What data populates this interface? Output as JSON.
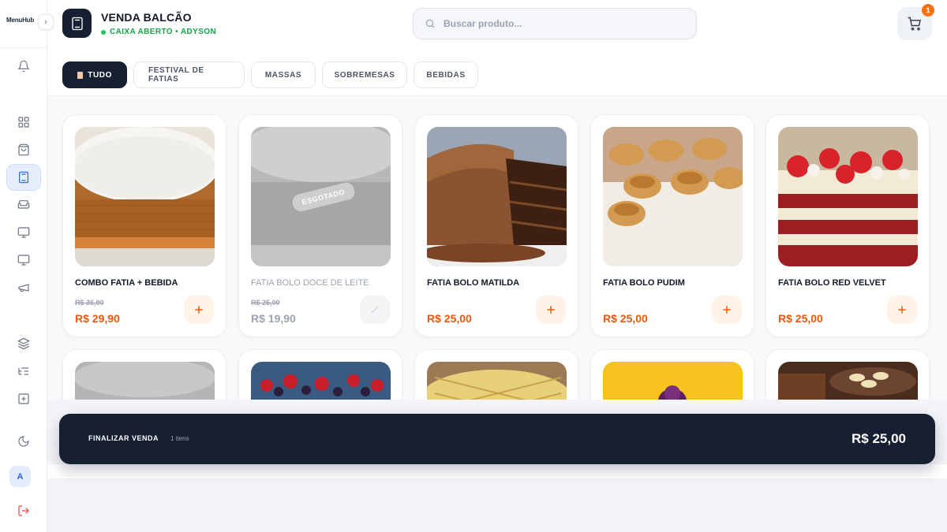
{
  "sidebar": {
    "logo": "MenuHub",
    "avatar_initial": "A",
    "icons": [
      "bell-icon",
      "grid-icon",
      "bag-icon",
      "calculator-icon",
      "sofa-icon",
      "monitor-icon",
      "display-icon",
      "megaphone-icon",
      "layers-icon",
      "tree-icon",
      "plus-square-icon",
      "moon-icon",
      "logout-icon"
    ],
    "active_icon": "calculator-icon"
  },
  "header": {
    "title": "VENDA BALCÃO",
    "status": "CAIXA ABERTO • ADYSON",
    "search_placeholder": "Buscar produto...",
    "cart_count": "1"
  },
  "tabs": [
    {
      "label": "TUDO",
      "active": true
    },
    {
      "label": "FESTIVAL DE FATIAS",
      "active": false
    },
    {
      "label": "MASSAS",
      "active": false
    },
    {
      "label": "SOBREMESAS",
      "active": false
    },
    {
      "label": "BEBIDAS",
      "active": false
    }
  ],
  "products": [
    {
      "name": "COMBO FATIA + BEBIDA",
      "old_price": "R$ 36,90",
      "price": "R$ 29,90",
      "available": true
    },
    {
      "name": "FATIA BOLO DOCE DE LEITE",
      "old_price": "R$ 25,00",
      "price": "R$ 19,90",
      "available": false,
      "badge": "ESGOTADO"
    },
    {
      "name": "FATIA BOLO MATILDA",
      "price": "R$ 25,00",
      "available": true
    },
    {
      "name": "FATIA BOLO PUDIM",
      "price": "R$ 25,00",
      "available": true
    },
    {
      "name": "FATIA BOLO RED VELVET",
      "price": "R$ 25,00",
      "available": true
    }
  ],
  "checkout": {
    "label": "FINALIZAR VENDA",
    "items": "1 itens",
    "total": "R$ 25,00"
  },
  "colors": {
    "dark": "#172033",
    "accent": "#ea580c",
    "status_green": "#16a34a",
    "badge": "#f97316"
  }
}
